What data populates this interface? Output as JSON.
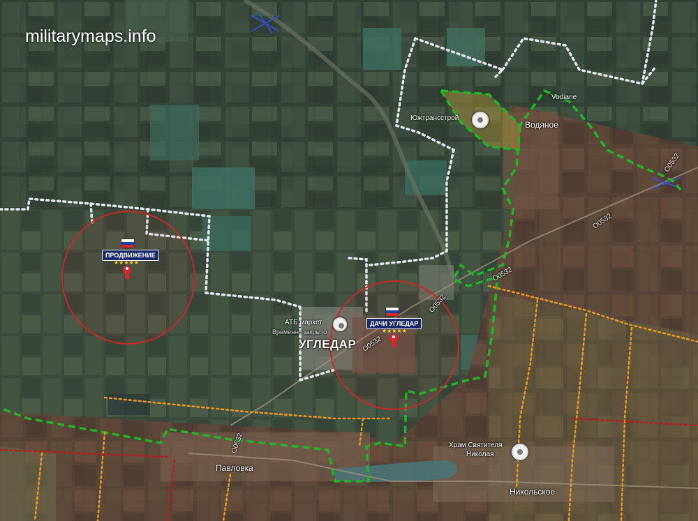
{
  "watermark": "militarymaps.info",
  "places": {
    "ugledar": "УГЛЕДАР",
    "pavlovka": "Павловка",
    "vodyanoe": "Водяное",
    "vodiane_latin": "Vodiane",
    "nikolskoe": "Никольское",
    "yuzhtransstroy": "Южтрансстрой",
    "atb_market": "АТБ маркет",
    "atb_sub": "Временно закрыто",
    "church_line1": "Храм Святителя",
    "church_line2": "Николая"
  },
  "roads": {
    "r1": "O0532",
    "r2": "O0532",
    "r3": "O0532",
    "r4": "O0532",
    "r5": "O0532",
    "r6": "O0532"
  },
  "markers": {
    "west": {
      "label": "ПРОДВИЖЕНИЕ",
      "stars": "★★★★★",
      "flag": "russia-flag"
    },
    "east": {
      "label": "ДАЧИ УГЛЕДАР",
      "stars": "★★★★★",
      "flag": "russia-flag"
    }
  },
  "colors": {
    "russian_control_line": "#1fb824",
    "contested_dots": "#e6e6f0",
    "frontline_orange": "#e89a22",
    "frontline_red": "#b41e1e",
    "advance_circle": "#c82828",
    "held_area_tint": "#7a3528",
    "industrial_tint": "#b49b3a",
    "marker_tag": "#1b2a6b",
    "flag_white": "#ffffff",
    "flag_blue": "#1c3fa8",
    "flag_red": "#d62828"
  }
}
